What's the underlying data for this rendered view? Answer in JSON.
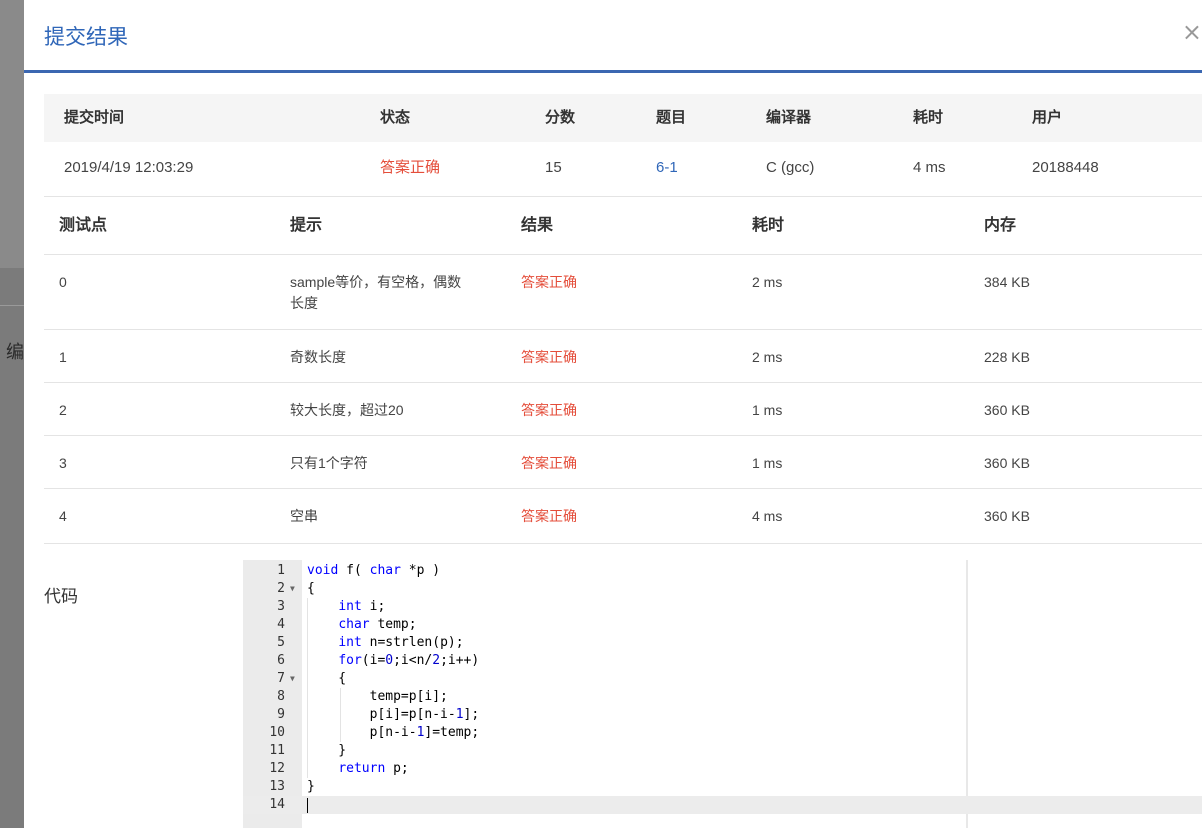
{
  "background": {
    "partial_text": "编"
  },
  "modal": {
    "title": "提交结果",
    "close": "×"
  },
  "summary": {
    "headers": [
      "提交时间",
      "状态",
      "分数",
      "题目",
      "编译器",
      "耗时",
      "用户"
    ],
    "row": {
      "time": "2019/4/19 12:03:29",
      "status": "答案正确",
      "score": "15",
      "problem": "6-1",
      "compiler": "C (gcc)",
      "duration": "4 ms",
      "user": "20188448"
    }
  },
  "tests": {
    "headers": [
      "测试点",
      "提示",
      "结果",
      "耗时",
      "内存"
    ],
    "rows": [
      {
        "id": "0",
        "hint_line1": "sample等价，有空格，偶数",
        "hint_line2": "长度",
        "result": "答案正确",
        "time": "2 ms",
        "memory": "384 KB"
      },
      {
        "id": "1",
        "hint_line1": "奇数长度",
        "hint_line2": "",
        "result": "答案正确",
        "time": "2 ms",
        "memory": "228 KB"
      },
      {
        "id": "2",
        "hint_line1": "较大长度，超过20",
        "hint_line2": "",
        "result": "答案正确",
        "time": "1 ms",
        "memory": "360 KB"
      },
      {
        "id": "3",
        "hint_line1": "只有1个字符",
        "hint_line2": "",
        "result": "答案正确",
        "time": "1 ms",
        "memory": "360 KB"
      },
      {
        "id": "4",
        "hint_line1": "空串",
        "hint_line2": "",
        "result": "答案正确",
        "time": "4 ms",
        "memory": "360 KB"
      }
    ]
  },
  "code_section": {
    "label": "代码",
    "fold_marker": "▼",
    "line_numbers": [
      "1",
      "2",
      "3",
      "4",
      "5",
      "6",
      "7",
      "8",
      "9",
      "10",
      "11",
      "12",
      "13",
      "14"
    ],
    "lines": [
      "void f( char *p )",
      "{",
      "    int i;",
      "    char temp;",
      "    int n=strlen(p);",
      "    for(i=0;i<n/2;i++)",
      "    {",
      "        temp=p[i];",
      "        p[i]=p[n-i-1];",
      "        p[n-i-1]=temp;",
      "    }",
      "    return p;",
      "}",
      ""
    ]
  },
  "colors": {
    "accent": "#3b67b1",
    "link": "#2f66b8",
    "success": "#e44d3a"
  }
}
